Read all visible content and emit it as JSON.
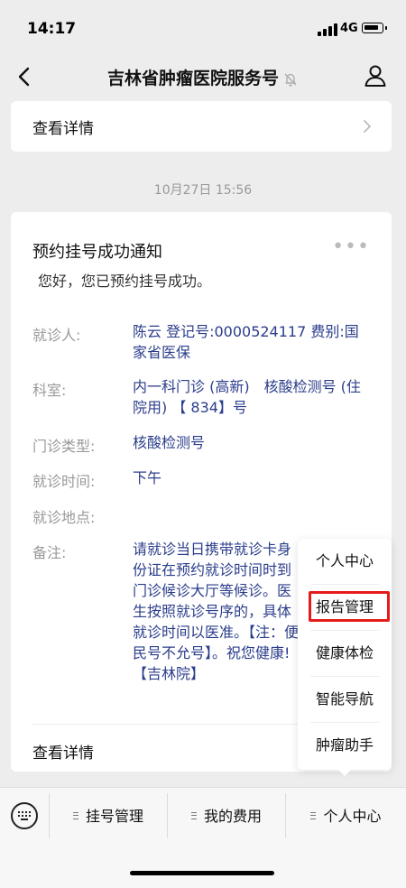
{
  "status": {
    "time": "14:17",
    "network": "4G"
  },
  "nav": {
    "title": "吉林省肿瘤医院服务号"
  },
  "top_card": {
    "link": "查看详情"
  },
  "timestamp": "10月27日 15:56",
  "message": {
    "title": "预约挂号成功通知",
    "greeting": "您好，您已预约挂号成功。",
    "fields": [
      {
        "label": "就诊人:",
        "value": "陈云 登记号:0000524117 费别:国家省医保"
      },
      {
        "label": "科室:",
        "value": "内一科门诊 (高新)　核酸检测号 (住院用) 【 834】号"
      },
      {
        "label": "门诊类型:",
        "value": "核酸检测号"
      },
      {
        "label": "就诊时间:",
        "value": "下午"
      },
      {
        "label": "就诊地点:",
        "value": ""
      },
      {
        "label": "备注:",
        "value": "请就诊当日携带就诊卡身份证在预约就诊时间时到门诊候诊大厅等候诊。医生按照就诊号序的，具体就诊时间以医准。【注：便民号不允号】。祝您健康!【吉林院】"
      }
    ],
    "detail_link": "查看详情"
  },
  "popup_menu": {
    "items": [
      "个人中心",
      "报告管理",
      "健康体检",
      "智能导航",
      "肿瘤助手"
    ],
    "highlighted_index": 1,
    "highlight_color": "#e51b1b"
  },
  "bottom_bar": {
    "tabs": [
      "挂号管理",
      "我的费用",
      "个人中心"
    ]
  },
  "colors": {
    "value_text": "#2b3d8b",
    "background": "#ededed"
  }
}
